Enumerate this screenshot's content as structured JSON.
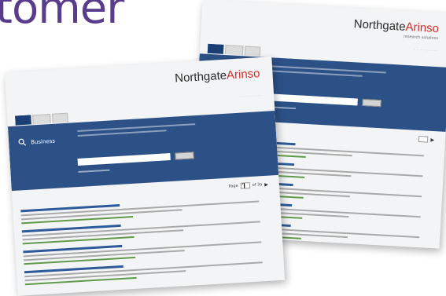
{
  "headline": "tomer",
  "colors": {
    "headline": "#5a3c8c",
    "band": "#2c5187",
    "logo_accent": "#d2302f"
  },
  "icons": [
    "search-icon",
    "next-arrow-icon"
  ],
  "screenshots": [
    {
      "logo": {
        "main": "Northgate",
        "accent": "Arinso",
        "sub": "research solutions"
      },
      "results": [
        1,
        2,
        3,
        4,
        5,
        6
      ]
    },
    {
      "logo": {
        "main": "Northgate",
        "accent": "Arinso"
      },
      "band": {
        "title": "Business"
      },
      "pager": {
        "label": "Page",
        "current": "1",
        "of": "of 3a"
      },
      "results": [
        1,
        2,
        3,
        4
      ]
    }
  ]
}
